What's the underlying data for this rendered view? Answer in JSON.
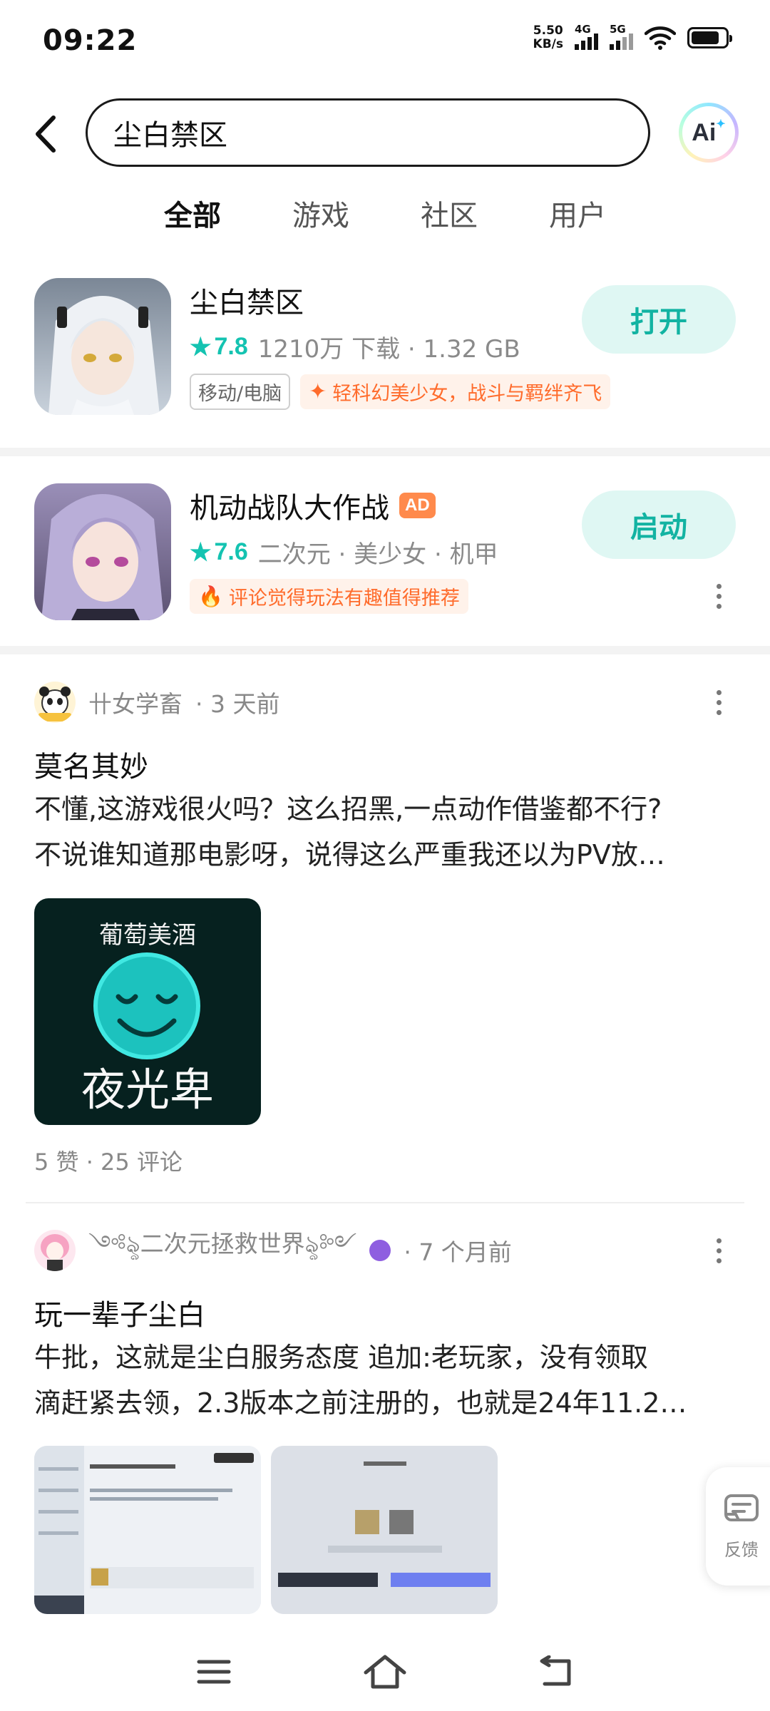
{
  "status_bar": {
    "time": "09:22",
    "net_speed_value": "5.50",
    "net_speed_unit": "KB/s",
    "sim1_label": "4G",
    "sim2_label": "5G"
  },
  "search": {
    "query": "尘白禁区",
    "ai_label": "Ai"
  },
  "tabs": [
    {
      "label": "全部",
      "active": true
    },
    {
      "label": "游戏",
      "active": false
    },
    {
      "label": "社区",
      "active": false
    },
    {
      "label": "用户",
      "active": false
    }
  ],
  "apps": [
    {
      "name": "尘白禁区",
      "rating": "7.8",
      "meta": "1210万 下载 · 1.32 GB",
      "tag_plain": "移动/电脑",
      "tag_hot": "轻科幻美少女，战斗与羁绊齐飞",
      "action": "打开",
      "icon": "anime-girl-white-hair"
    },
    {
      "name": "机动战队大作战",
      "ad": "AD",
      "rating": "7.6",
      "meta": "二次元 · 美少女 · 机甲",
      "tag_hot": "评论觉得玩法有趣值得推荐",
      "action": "启动",
      "icon": "anime-girl-silver-hair"
    }
  ],
  "posts": [
    {
      "author": "卄女学畜",
      "time": "· 3 天前",
      "title": "莫名其妙",
      "lines": [
        "不懂,这游戏很火吗？这么招黑,一点动作借鉴都不行?",
        "不说谁知道那电影呀，说得这么严重我还以为PV放…"
      ],
      "image_caption_top": "葡萄美酒",
      "image_caption_bottom": "夜光卑",
      "stats": "5 赞 · 25 评论"
    },
    {
      "author": "༺ৡ二次元拯救世界ৡ༻",
      "time": "· 7 个月前",
      "title": "玩一辈子尘白",
      "lines": [
        "牛批，这就是尘白服务态度 追加:老玩家，没有领取",
        "滴赶紧去领，2.3版本之前注册的，也就是24年11.2…"
      ]
    }
  ],
  "feedback_label": "反馈",
  "colors": {
    "accent": "#2fd3c4",
    "rating": "#14c3b1",
    "hot_tag": "#ff6b2b",
    "ad_badge": "#ff8a4c"
  }
}
